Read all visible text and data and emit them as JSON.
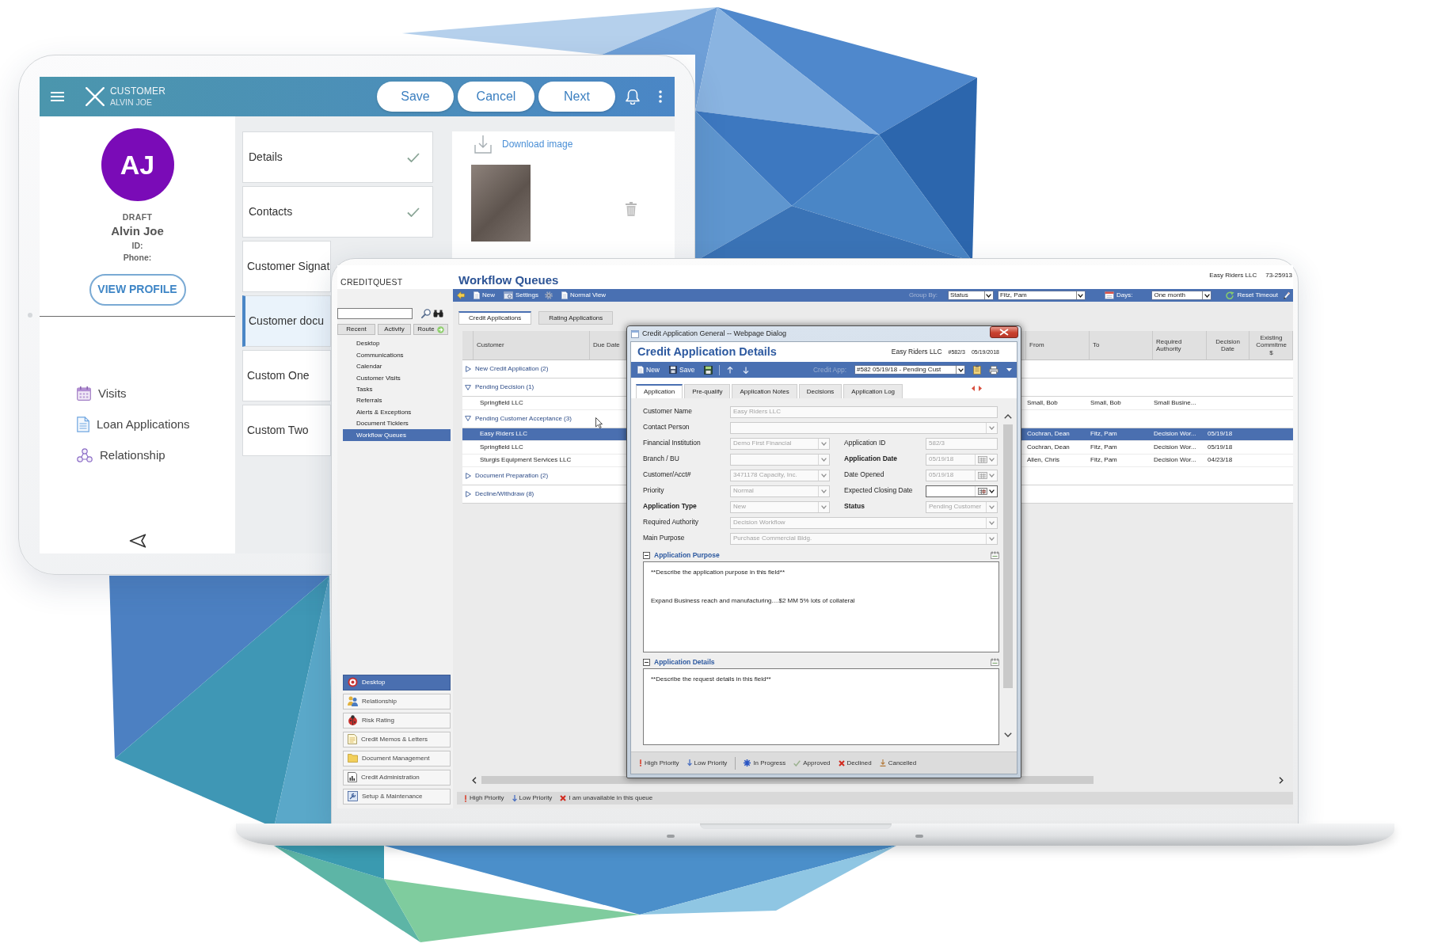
{
  "tablet": {
    "header": {
      "title": "CUSTOMER",
      "subtitle": "ALVIN JOE",
      "buttons": [
        "Save",
        "Cancel",
        "Next"
      ]
    },
    "profile": {
      "initials": "AJ",
      "status": "DRAFT",
      "name": "Alvin Joe",
      "fields": [
        "ID:",
        "Phone:"
      ],
      "button": "VIEW PROFILE"
    },
    "nav": [
      "Visits",
      "Loan Applications",
      "Relationship"
    ],
    "sections": [
      {
        "label": "Details",
        "checked": true,
        "selected": false
      },
      {
        "label": "Contacts",
        "checked": true,
        "selected": false
      },
      {
        "label": "Customer Signat",
        "checked": false,
        "selected": false
      },
      {
        "label": "Customer docu",
        "checked": false,
        "selected": true
      },
      {
        "label": "Custom One",
        "checked": false,
        "selected": false
      },
      {
        "label": "Custom Two",
        "checked": false,
        "selected": false
      }
    ],
    "attachment": {
      "link": "Download image"
    }
  },
  "laptop": {
    "logo": "CREDITQUEST",
    "title": "Workflow Queues",
    "customer": "Easy Riders LLC",
    "account": "73-25913",
    "sidebar": {
      "tabs": [
        "Recent",
        "Activity",
        "Route"
      ],
      "items": [
        {
          "label": "Desktop",
          "selected": false
        },
        {
          "label": "Communications",
          "selected": false
        },
        {
          "label": "Calendar",
          "selected": false
        },
        {
          "label": "Customer Visits",
          "selected": false
        },
        {
          "label": "Tasks",
          "selected": false
        },
        {
          "label": "Referrals",
          "selected": false
        },
        {
          "label": "Alerts & Exceptions",
          "selected": false
        },
        {
          "label": "Document Ticklers",
          "selected": false
        },
        {
          "label": "Workflow Queues",
          "selected": true
        }
      ],
      "modules": [
        {
          "label": "Desktop",
          "selected": true
        },
        {
          "label": "Relationship",
          "selected": false
        },
        {
          "label": "Risk Rating",
          "selected": false
        },
        {
          "label": "Credit Memos & Letters",
          "selected": false
        },
        {
          "label": "Document Management",
          "selected": false
        },
        {
          "label": "Credit Administration",
          "selected": false
        },
        {
          "label": "Setup & Maintenance",
          "selected": false
        }
      ]
    },
    "toolbar": {
      "buttons": [
        "New",
        "Settings",
        "Normal View"
      ],
      "group_by_label": "Group By:",
      "group_by": "Status",
      "assignee": "Fitz, Pam",
      "days_label": "Days:",
      "days": "One month",
      "reset": "Reset Timeout"
    },
    "tabs": [
      {
        "label": "Credit Applications",
        "selected": true
      },
      {
        "label": "Rating Applications",
        "selected": false
      }
    ],
    "table": {
      "columns": [
        "Customer",
        "Due Date",
        "From",
        "To",
        "Required Authority",
        "Decision Date",
        "Existing Commitme $"
      ],
      "groups": [
        {
          "label": "New Credit Application (2)",
          "expanded": false
        },
        {
          "label": "Pending Decision (1)",
          "expanded": true,
          "rows": [
            {
              "customer": "Springfield LLC",
              "from": "Small, Bob",
              "to": "Small, Bob",
              "authority": "Small Busine...",
              "selected": false
            }
          ]
        },
        {
          "label": "Pending Customer Acceptance (3)",
          "expanded": true,
          "rows": [
            {
              "customer": "Easy Riders LLC",
              "from": "Cochran, Dean",
              "to": "Fitz, Pam",
              "authority": "Decision Wor...",
              "decision_date": "05/19/18",
              "selected": true
            },
            {
              "customer": "Springfield LLC",
              "from": "Cochran, Dean",
              "to": "Fitz, Pam",
              "authority": "Decision Wor...",
              "decision_date": "05/19/18",
              "selected": false
            },
            {
              "customer": "Sturgis Equipment Services LLC",
              "from": "Allen, Chris",
              "to": "Fitz, Pam",
              "authority": "Decision Wor...",
              "decision_date": "04/23/18",
              "selected": false
            }
          ]
        },
        {
          "label": "Document Preparation (2)",
          "expanded": false
        },
        {
          "label": "Decline/Withdraw (8)",
          "expanded": false
        }
      ]
    },
    "status_bar": [
      "High Priority",
      "Low Priority",
      "I am unavailable in this queue"
    ],
    "dialog": {
      "window_title": "Credit Application General -- Webpage Dialog",
      "title": "Credit Application Details",
      "customer": "Easy Riders LLC",
      "number": "#582/3",
      "date": "05/19/2018",
      "toolbar": {
        "buttons": [
          "New",
          "Save"
        ],
        "credit_app_label": "Credit App:",
        "credit_app": "#582 05/19/18 - Pending Cust"
      },
      "tabs": [
        {
          "label": "Application",
          "selected": true
        },
        {
          "label": "Pre-qualify",
          "selected": false
        },
        {
          "label": "Application Notes",
          "selected": false
        },
        {
          "label": "Decisions",
          "selected": false
        },
        {
          "label": "Application Log",
          "selected": false
        }
      ],
      "form": [
        [
          {
            "label": "Customer Name",
            "kind": "text",
            "value": "Easy Riders LLC",
            "required": false,
            "disabled": true
          }
        ],
        [
          {
            "label": "Contact Person",
            "kind": "select",
            "required": false,
            "disabled": true
          }
        ],
        [
          {
            "label": "Financial Institution",
            "kind": "select",
            "value": "Demo First Financial",
            "required": false,
            "disabled": true
          },
          {
            "label": "Application ID",
            "kind": "text",
            "value": "582/3",
            "required": false,
            "disabled": true
          }
        ],
        [
          {
            "label": "Branch / BU",
            "kind": "select",
            "required": false,
            "disabled": true
          },
          {
            "label": "Application Date",
            "kind": "date",
            "value": "05/19/18",
            "required": true,
            "disabled": true
          }
        ],
        [
          {
            "label": "Customer/Acct#",
            "kind": "select",
            "value": "3471178 Capacity, Inc.",
            "required": false,
            "disabled": true
          },
          {
            "label": "Date Opened",
            "kind": "date",
            "value": "05/19/18",
            "required": false,
            "disabled": true
          }
        ],
        [
          {
            "label": "Priority",
            "kind": "select",
            "value": "Normal",
            "required": false,
            "disabled": true
          },
          {
            "label": "Expected Closing Date",
            "kind": "date",
            "required": false,
            "disabled": false
          }
        ],
        [
          {
            "label": "Application Type",
            "kind": "select",
            "value": "New",
            "required": true,
            "disabled": true
          },
          {
            "label": "Status",
            "kind": "select",
            "value": "Pending Customer",
            "required": true,
            "disabled": true
          }
        ],
        [
          {
            "label": "Required Authority",
            "kind": "select",
            "value": "Decision Workflow",
            "required": false,
            "disabled": true
          }
        ],
        [
          {
            "label": "Main Purpose",
            "kind": "select",
            "value": "Purchase Commercial Bldg.",
            "required": false,
            "disabled": true
          }
        ]
      ],
      "sections": [
        {
          "title": "Application Purpose",
          "expanded": true,
          "lines": [
            "**Describe the application purpose in this field**",
            "Expand Business reach and manufacturing....$2 MM 5% lots of collateral"
          ]
        },
        {
          "title": "Application Details",
          "expanded": true,
          "lines": [
            "**Describe the request details in this field**"
          ]
        }
      ],
      "legend": [
        [
          "High Priority",
          "Low Priority"
        ],
        [
          "In Progress",
          "Approved",
          "Declined",
          "Cancelled"
        ]
      ]
    }
  }
}
